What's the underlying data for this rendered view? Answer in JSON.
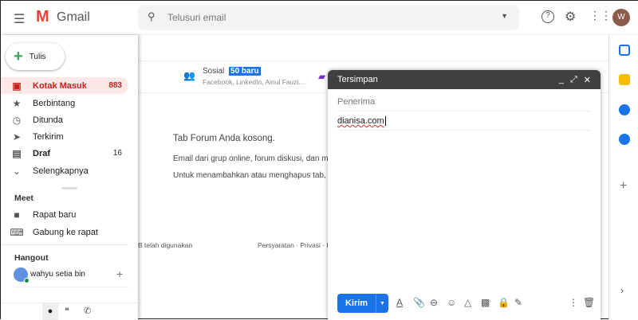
{
  "header": {
    "app_name": "Gmail",
    "search_placeholder": "Telusuri email",
    "avatar_letter": "W"
  },
  "sidebar": {
    "compose_label": "Tulis",
    "items": [
      {
        "label": "Kotak Masuk",
        "count": "883",
        "icon": "inbox-icon",
        "active": true
      },
      {
        "label": "Berbintang",
        "count": "",
        "icon": "star-icon"
      },
      {
        "label": "Ditunda",
        "count": "",
        "icon": "clock-icon"
      },
      {
        "label": "Terkirim",
        "count": "",
        "icon": "send-icon"
      },
      {
        "label": "Draf",
        "count": "16",
        "icon": "draft-icon"
      },
      {
        "label": "Selengkapnya",
        "count": "",
        "icon": "chevron-down-icon"
      }
    ],
    "meet": {
      "title": "Meet",
      "items": [
        "Rapat baru",
        "Gabung ke rapat"
      ]
    },
    "hangout": {
      "title": "Hangout",
      "user": "wahyu setia bin"
    }
  },
  "main": {
    "tab": {
      "label": "Sosial",
      "badge": "50 baru",
      "snippet": "Facebook, LinkedIn, Ainul Fauzi..."
    },
    "empty_title": "Tab Forum Anda kosong.",
    "empty_line1": "Email dari grup online, forum diskusi, dan milis",
    "empty_line2": "Untuk menambahkan atau menghapus tab, klik",
    "footer_storage": "B telah digunakan",
    "footer_links": "Persyaratan · Privasi · K"
  },
  "compose": {
    "title": "Tersimpan",
    "recipient_placeholder": "Penerima",
    "subject_value": "dianisa.com",
    "send_label": "Kirim"
  },
  "colors": {
    "accent": "#1a73e8",
    "active_bg": "#fce8e6",
    "active_text": "#c5221f",
    "compose_header": "#404040"
  }
}
